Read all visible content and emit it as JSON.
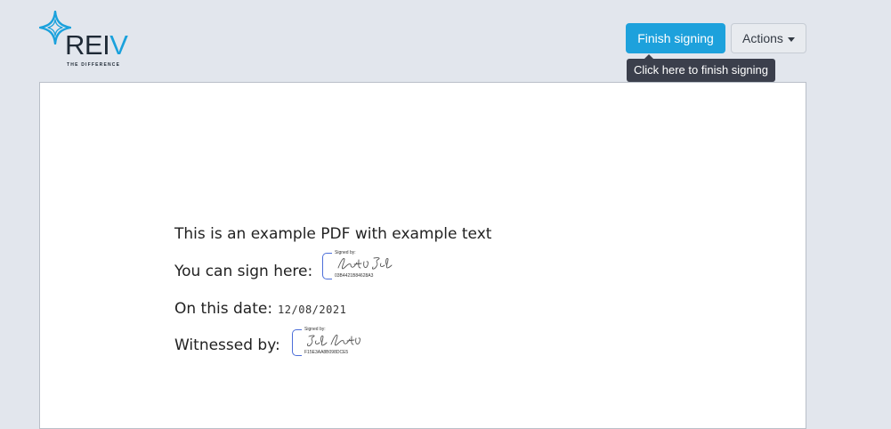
{
  "header": {
    "logo": {
      "word_main": "REI",
      "word_accent": "V",
      "tagline": "THE DIFFERENCE"
    },
    "finish_button_label": "Finish signing",
    "actions_button_label": "Actions",
    "tooltip_text": "Click here to finish signing"
  },
  "document": {
    "line1": "This is an example PDF with example text",
    "line2_label": "You can sign here:",
    "line3_label": "On this date:",
    "date_value": "12/08/2021",
    "line4_label": "Witnessed by:",
    "signature1": {
      "label": "Signed by:",
      "hash": "03B4421B84628A3"
    },
    "signature2": {
      "label": "Signed by:",
      "hash": "F15E3AA8B098DCE5"
    }
  },
  "colors": {
    "background": "#e2e6ed",
    "brand_accent": "#1aa1dc",
    "finish_button": "#1da1dc",
    "tooltip_bg": "#3b3f4c",
    "signature_bracket": "#4c6ed9"
  },
  "icons": {
    "logo": "reiv-star-logo",
    "actions_dropdown": "caret-down-icon"
  }
}
